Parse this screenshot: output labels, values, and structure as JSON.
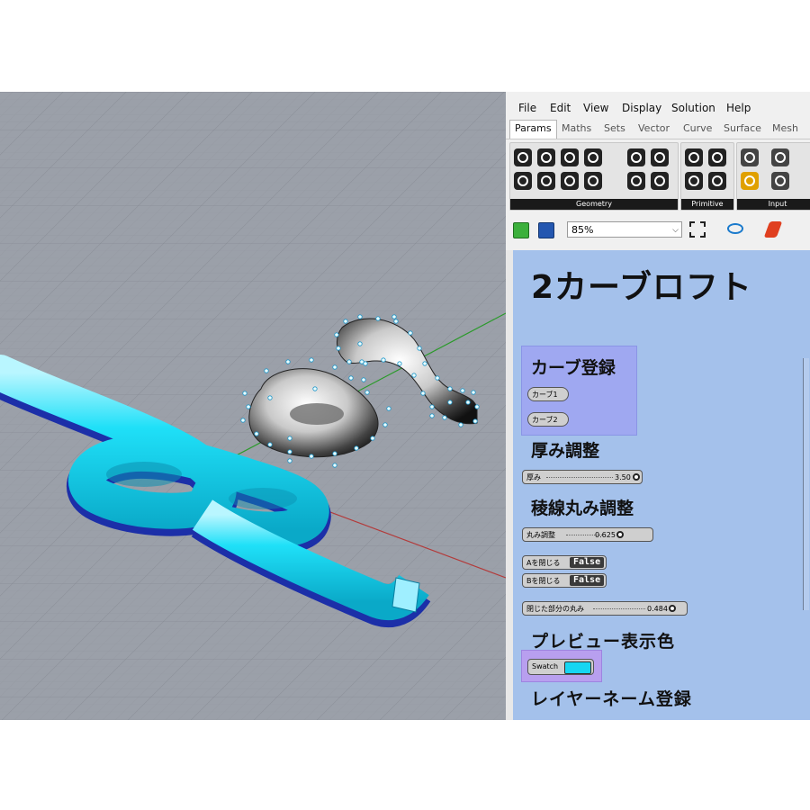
{
  "menu": [
    "File",
    "Edit",
    "View",
    "Display",
    "Solution",
    "Help"
  ],
  "tabs": [
    {
      "label": "Params",
      "active": true
    },
    {
      "label": "Maths"
    },
    {
      "label": "Sets"
    },
    {
      "label": "Vector"
    },
    {
      "label": "Curve"
    },
    {
      "label": "Surface"
    },
    {
      "label": "Mesh"
    }
  ],
  "ribbon_groups": [
    "Geometry",
    "Primitive",
    "Input"
  ],
  "zoom": "85%",
  "canvas": {
    "title": "2カーブロフト",
    "curve_group": "カーブ登録",
    "curve1": "カーブ1",
    "curve2": "カーブ2",
    "thickness_heading": "厚み調整",
    "thickness_label": "厚み",
    "thickness_value": "3.50",
    "fillet_heading": "稜線丸み調整",
    "fillet_label": "丸み調整",
    "fillet_value": "0.625",
    "closeA_label": "Aを閉じる",
    "closeB_label": "Bを閉じる",
    "toggle_value": "False",
    "closed_fillet_label": "閉じた部分の丸み",
    "closed_fillet_value": "0.484",
    "preview_heading": "プレビュー表示色",
    "swatch_label": "Swatch",
    "swatch_color": "#16d6f2",
    "layer_heading": "レイヤーネーム登録"
  },
  "colors": {
    "viewport_bg": "#9ba0a9",
    "cyan_tube": "#18dcf5",
    "canvas_bg": "#a4c1eb"
  }
}
